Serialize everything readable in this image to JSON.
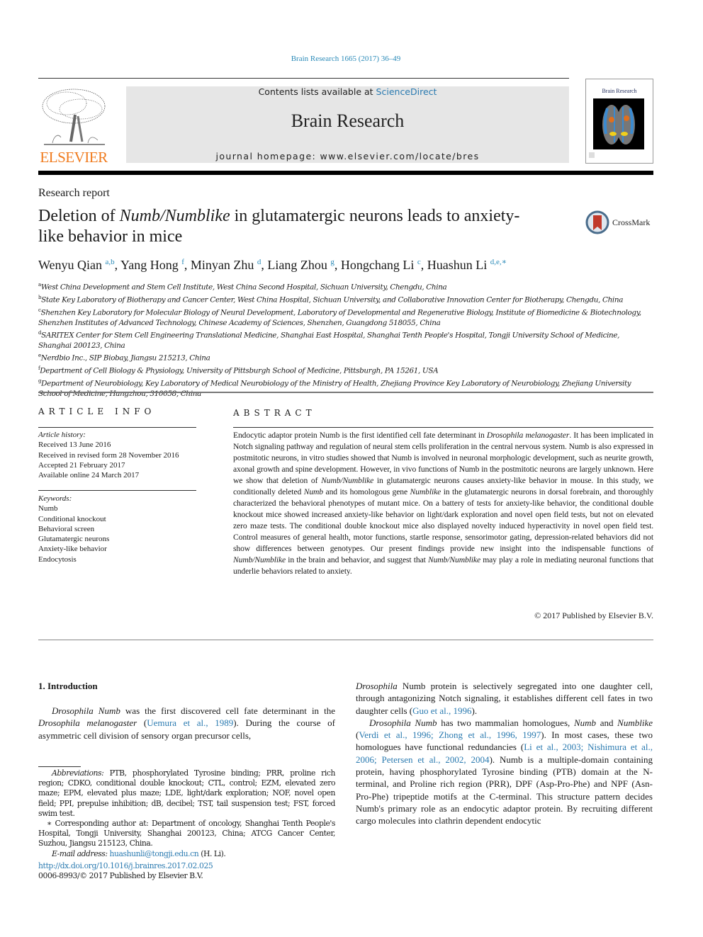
{
  "header": {
    "journal_ref": "Brain Research 1665 (2017) 36–49",
    "contents_prefix": "Contents lists available at ",
    "contents_link": "ScienceDirect",
    "journal_title": "Brain Research",
    "homepage_line": "journal homepage: www.elsevier.com/locate/bres",
    "publisher_logo_text": "ELSEVIER",
    "cover_title": "Brain Research"
  },
  "colors": {
    "link": "#2a7ab0",
    "elsevier_orange": "#f07b1e",
    "crossmark_red": "#c0392b"
  },
  "article": {
    "type": "Research report",
    "title_parts": [
      "Deletion of ",
      "Numb/Numblike",
      " in glutamatergic neurons leads to anxiety-like behavior in mice"
    ],
    "crossmark_label": "CrossMark",
    "authors": [
      {
        "name": "Wenyu Qian",
        "sup": "a,b"
      },
      {
        "name": "Yang Hong",
        "sup": "f"
      },
      {
        "name": "Minyan Zhu",
        "sup": "d"
      },
      {
        "name": "Liang Zhou",
        "sup": "g"
      },
      {
        "name": "Hongchang Li",
        "sup": "c"
      },
      {
        "name": "Huashun Li",
        "sup": "d,e,∗"
      }
    ],
    "affiliations": [
      {
        "key": "a",
        "text": "West China Development and Stem Cell Institute, West China Second Hospital, Sichuan University, Chengdu, China"
      },
      {
        "key": "b",
        "text": "State Key Laboratory of Biotherapy and Cancer Center, West China Hospital, Sichuan University, and Collaborative Innovation Center for Biotherapy, Chengdu, China"
      },
      {
        "key": "c",
        "text": "Shenzhen Key Laboratory for Molecular Biology of Neural Development, Laboratory of Developmental and Regenerative Biology, Institute of Biomedicine & Biotechnology, Shenzhen Institutes of Advanced Technology, Chinese Academy of Sciences, Shenzhen, Guangdong 518055, China"
      },
      {
        "key": "d",
        "text": "SARITEX Center for Stem Cell Engineering Translational Medicine, Shanghai East Hospital, Shanghai Tenth People's Hospital, Tongji University School of Medicine, Shanghai 200123, China"
      },
      {
        "key": "e",
        "text": "Nerdbio Inc., SIP Biobay, Jiangsu 215213, China"
      },
      {
        "key": "f",
        "text": "Department of Cell Biology & Physiology, University of Pittsburgh School of Medicine, Pittsburgh, PA 15261, USA"
      },
      {
        "key": "g",
        "text": "Department of Neurobiology, Key Laboratory of Medical Neurobiology of the Ministry of Health, Zhejiang Province Key Laboratory of Neurobiology, Zhejiang University School of Medicine, Hangzhou, 310058, China"
      }
    ]
  },
  "article_info": {
    "heading": "ARTICLE INFO",
    "history_label": "Article history:",
    "history": [
      "Received 13 June 2016",
      "Received in revised form 28 November 2016",
      "Accepted 21 February 2017",
      "Available online 24 March 2017"
    ],
    "keywords_label": "Keywords:",
    "keywords": [
      "Numb",
      "Conditional knockout",
      "Behavioral screen",
      "Glutamatergic neurons",
      "Anxiety-like behavior",
      "Endocytosis"
    ]
  },
  "abstract": {
    "heading": "ABSTRACT",
    "segments": [
      {
        "t": "Endocytic adaptor protein Numb is the first identified cell fate determinant in "
      },
      {
        "t": "Drosophila melanogaster",
        "i": true
      },
      {
        "t": ". It has been implicated in Notch signaling pathway and regulation of neural stem cells proliferation in the central nervous system. Numb is also expressed in postmitotic neurons, in vitro studies showed that Numb is involved in neuronal morphologic development, such as neurite growth, axonal growth and spine development. However, in vivo functions of Numb in the postmitotic neurons are largely unknown. Here we show that deletion of "
      },
      {
        "t": "Numb/Numblike",
        "i": true
      },
      {
        "t": " in glutamatergic neurons causes anxiety-like behavior in mouse. In this study, we conditionally deleted "
      },
      {
        "t": "Numb",
        "i": true
      },
      {
        "t": " and its homologous gene "
      },
      {
        "t": "Numblike",
        "i": true
      },
      {
        "t": " in the glutamatergic neurons in dorsal forebrain, and thoroughly characterized the behavioral phenotypes of mutant mice. On a battery of tests for anxiety-like behavior, the conditional double knockout mice showed increased anxiety-like behavior on light/dark exploration and novel open field tests, but not on elevated zero maze tests. The conditional double knockout mice also displayed novelty induced hyperactivity in novel open field test. Control measures of general health, motor functions, startle response, sensorimotor gating, depression-related behaviors did not show differences between genotypes. Our present findings provide new insight into the indispensable functions of "
      },
      {
        "t": "Numb/Numblike",
        "i": true
      },
      {
        "t": " in the brain and behavior, and suggest that "
      },
      {
        "t": "Numb/Numblike",
        "i": true
      },
      {
        "t": " may play a role in mediating neuronal functions that underlie behaviors related to anxiety."
      }
    ],
    "copyright": "© 2017 Published by Elsevier B.V."
  },
  "introduction": {
    "heading": "1. Introduction",
    "left_paragraph": [
      {
        "t": "Drosophila Numb",
        "i": true
      },
      {
        "t": " was the first discovered cell fate determinant in the "
      },
      {
        "t": "Drosophila melanogaster",
        "i": true
      },
      {
        "t": " ("
      },
      {
        "t": "Uemura et al., 1989",
        "link": true
      },
      {
        "t": "). During the course of asymmetric cell division of sensory organ precursor cells,"
      }
    ],
    "right_paragraph_1": [
      {
        "t": "Drosophila",
        "i": true
      },
      {
        "t": " Numb protein is selectively segregated into one daughter cell, through antagonizing Notch signaling, it establishes different cell fates in two daughter cells ("
      },
      {
        "t": "Guo et al., 1996",
        "link": true
      },
      {
        "t": ")."
      }
    ],
    "right_paragraph_2": [
      {
        "t": "Drosophila Numb",
        "i": true
      },
      {
        "t": " has two mammalian homologues, "
      },
      {
        "t": "Numb",
        "i": true
      },
      {
        "t": " and "
      },
      {
        "t": "Numblike",
        "i": true
      },
      {
        "t": " ("
      },
      {
        "t": "Verdi et al., 1996; Zhong et al., 1996, 1997",
        "link": true
      },
      {
        "t": "). In most cases, these two homologues have functional redundancies ("
      },
      {
        "t": "Li et al., 2003; Nishimura et al., 2006; Petersen et al., 2002, 2004",
        "link": true
      },
      {
        "t": "). Numb is a multiple-domain containing protein, having phosphorylated Tyrosine binding (PTB) domain at the N-terminal, and Proline rich region (PRR), DPF (Asp-Pro-Phe) and NPF (Asn-Pro-Phe) tripeptide motifs at the C-terminal. This structure pattern decides Numb's primary role as an endocytic adaptor protein. By recruiting different cargo molecules into clathrin dependent endocytic"
      }
    ]
  },
  "footnotes": {
    "abbreviations_label": "Abbreviations:",
    "abbreviations": " PTB, phosphorylated Tyrosine binding; PRR, proline rich region; CDKO, conditional double knockout; CTL, control; EZM, elevated zero maze; EPM, elevated plus maze; LDE, light/dark exploration; NOF, novel open field; PPI, prepulse inhibition; dB, decibel; TST, tail suspension test; FST, forced swim test.",
    "corresponding": "∗ Corresponding author at: Department of oncology, Shanghai Tenth People's Hospital, Tongji University, Shanghai 200123, China; ATCG Cancer Center, Suzhou, Jiangsu 215123, China.",
    "email_label": "E-mail address:",
    "email": "huashunli@tongji.edu.cn",
    "email_suffix": " (H. Li).",
    "doi": "http://dx.doi.org/10.1016/j.brainres.2017.02.025",
    "issn_line": "0006-8993/© 2017 Published by Elsevier B.V."
  }
}
